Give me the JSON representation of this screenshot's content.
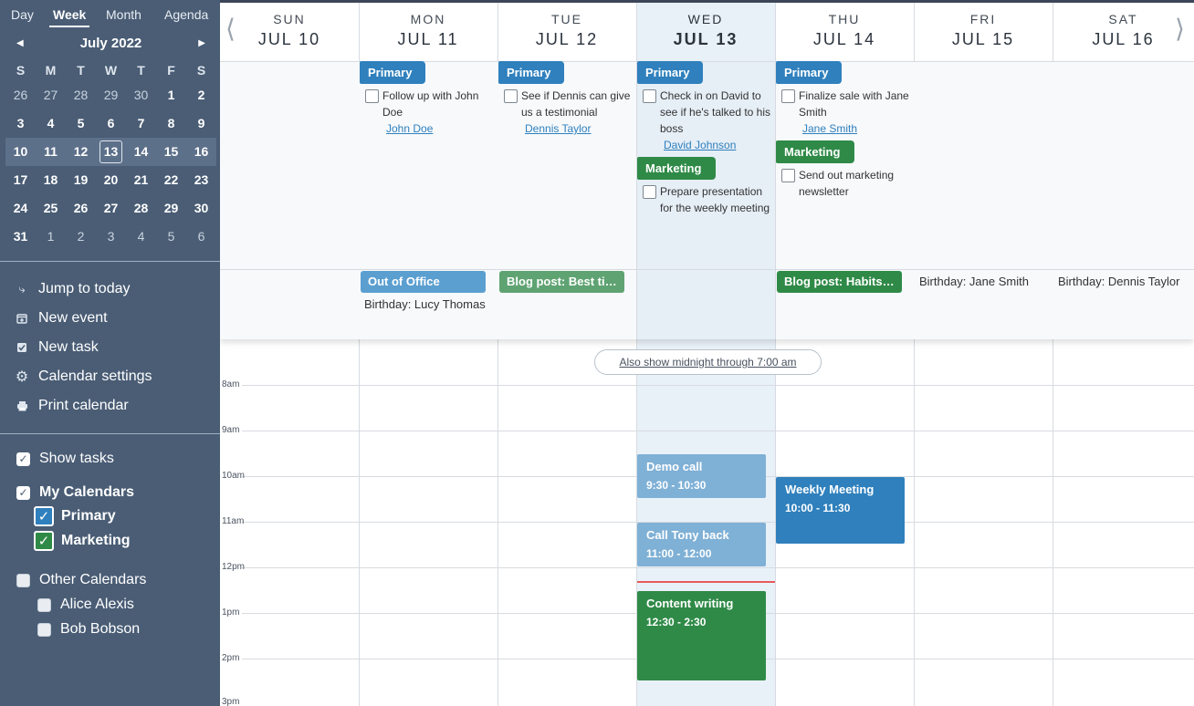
{
  "sidebar": {
    "view_tabs": [
      "Day",
      "Week",
      "Month",
      "Agenda"
    ],
    "mini_calendar": {
      "title": "July 2022",
      "prev_icon": "triangle-left-icon",
      "next_icon": "triangle-right-icon",
      "weekday_headers": [
        "S",
        "M",
        "T",
        "W",
        "T",
        "F",
        "S"
      ],
      "weeks": [
        [
          "26",
          "27",
          "28",
          "29",
          "30",
          "1",
          "2"
        ],
        [
          "3",
          "4",
          "5",
          "6",
          "7",
          "8",
          "9"
        ],
        [
          "10",
          "11",
          "12",
          "13",
          "14",
          "15",
          "16"
        ],
        [
          "17",
          "18",
          "19",
          "20",
          "21",
          "22",
          "23"
        ],
        [
          "24",
          "25",
          "26",
          "27",
          "28",
          "29",
          "30"
        ],
        [
          "31",
          "1",
          "2",
          "3",
          "4",
          "5",
          "6"
        ]
      ],
      "today": "13"
    },
    "actions": [
      {
        "label": "Jump to today",
        "icon": "jump-arrow-icon"
      },
      {
        "label": "New event",
        "icon": "calendar-add-icon"
      },
      {
        "label": "New task",
        "icon": "task-check-icon"
      },
      {
        "label": "Calendar settings",
        "icon": "gear-icon"
      },
      {
        "label": "Print calendar",
        "icon": "printer-icon"
      }
    ],
    "show_tasks": "Show tasks",
    "my_calendars": {
      "label": "My Calendars",
      "items": [
        {
          "label": "Primary",
          "color": "#2f80bd"
        },
        {
          "label": "Marketing",
          "color": "#2f8a47"
        }
      ]
    },
    "other_calendars": {
      "label": "Other Calendars",
      "items": [
        "Alice Alexis",
        "Bob Bobson"
      ]
    }
  },
  "week": {
    "prev_icon": "chevron-left-icon",
    "next_icon": "chevron-right-icon",
    "days": [
      {
        "name": "SUN",
        "date": "JUL 10"
      },
      {
        "name": "MON",
        "date": "JUL 11"
      },
      {
        "name": "TUE",
        "date": "JUL 12"
      },
      {
        "name": "WED",
        "date": "JUL 13"
      },
      {
        "name": "THU",
        "date": "JUL 14"
      },
      {
        "name": "FRI",
        "date": "JUL 15"
      },
      {
        "name": "SAT",
        "date": "JUL 16"
      }
    ]
  },
  "tasks": {
    "primary_tag": "Primary",
    "marketing_tag": "Marketing",
    "mon": {
      "text": "Follow up with John Doe",
      "link": "John Doe"
    },
    "tue": {
      "text": "See if Dennis can give us a testimonial",
      "link": "Dennis Taylor"
    },
    "wed_primary": {
      "text": "Check in on David to see if he's talked to his boss",
      "link": "David Johnson"
    },
    "wed_marketing": {
      "text": "Prepare presentation for the weekly meeting"
    },
    "thu_primary": {
      "text": "Finalize sale with Jane Smith",
      "link": "Jane Smith"
    },
    "thu_marketing": {
      "text": "Send out marketing newsletter"
    }
  },
  "allday": {
    "mon_event": "Out of Office",
    "mon_birthday": "Birthday: Lucy Thomas",
    "tue_event": "Blog post: Best tip...",
    "thu_event": "Blog post: Habits f...",
    "fri_birthday": "Birthday: Jane Smith",
    "sat_birthday": "Birthday: Dennis Taylor"
  },
  "timegrid": {
    "show_midnight": "Also show midnight through 7:00 am",
    "hours": [
      "8am",
      "9am",
      "10am",
      "11am",
      "12pm",
      "1pm",
      "2pm",
      "3pm"
    ]
  },
  "events": {
    "demo": {
      "title": "Demo call",
      "time": "9:30 - 10:30",
      "color": "#7fb0d6"
    },
    "tony": {
      "title": "Call Tony back",
      "time": "11:00 - 12:00",
      "color": "#7fb0d6"
    },
    "content": {
      "title": "Content writing",
      "time": "12:30 - 2:30",
      "color": "#2f8a47"
    },
    "weekly": {
      "title": "Weekly Meeting",
      "time": "10:00 - 11:30",
      "color": "#2f80bd"
    }
  }
}
